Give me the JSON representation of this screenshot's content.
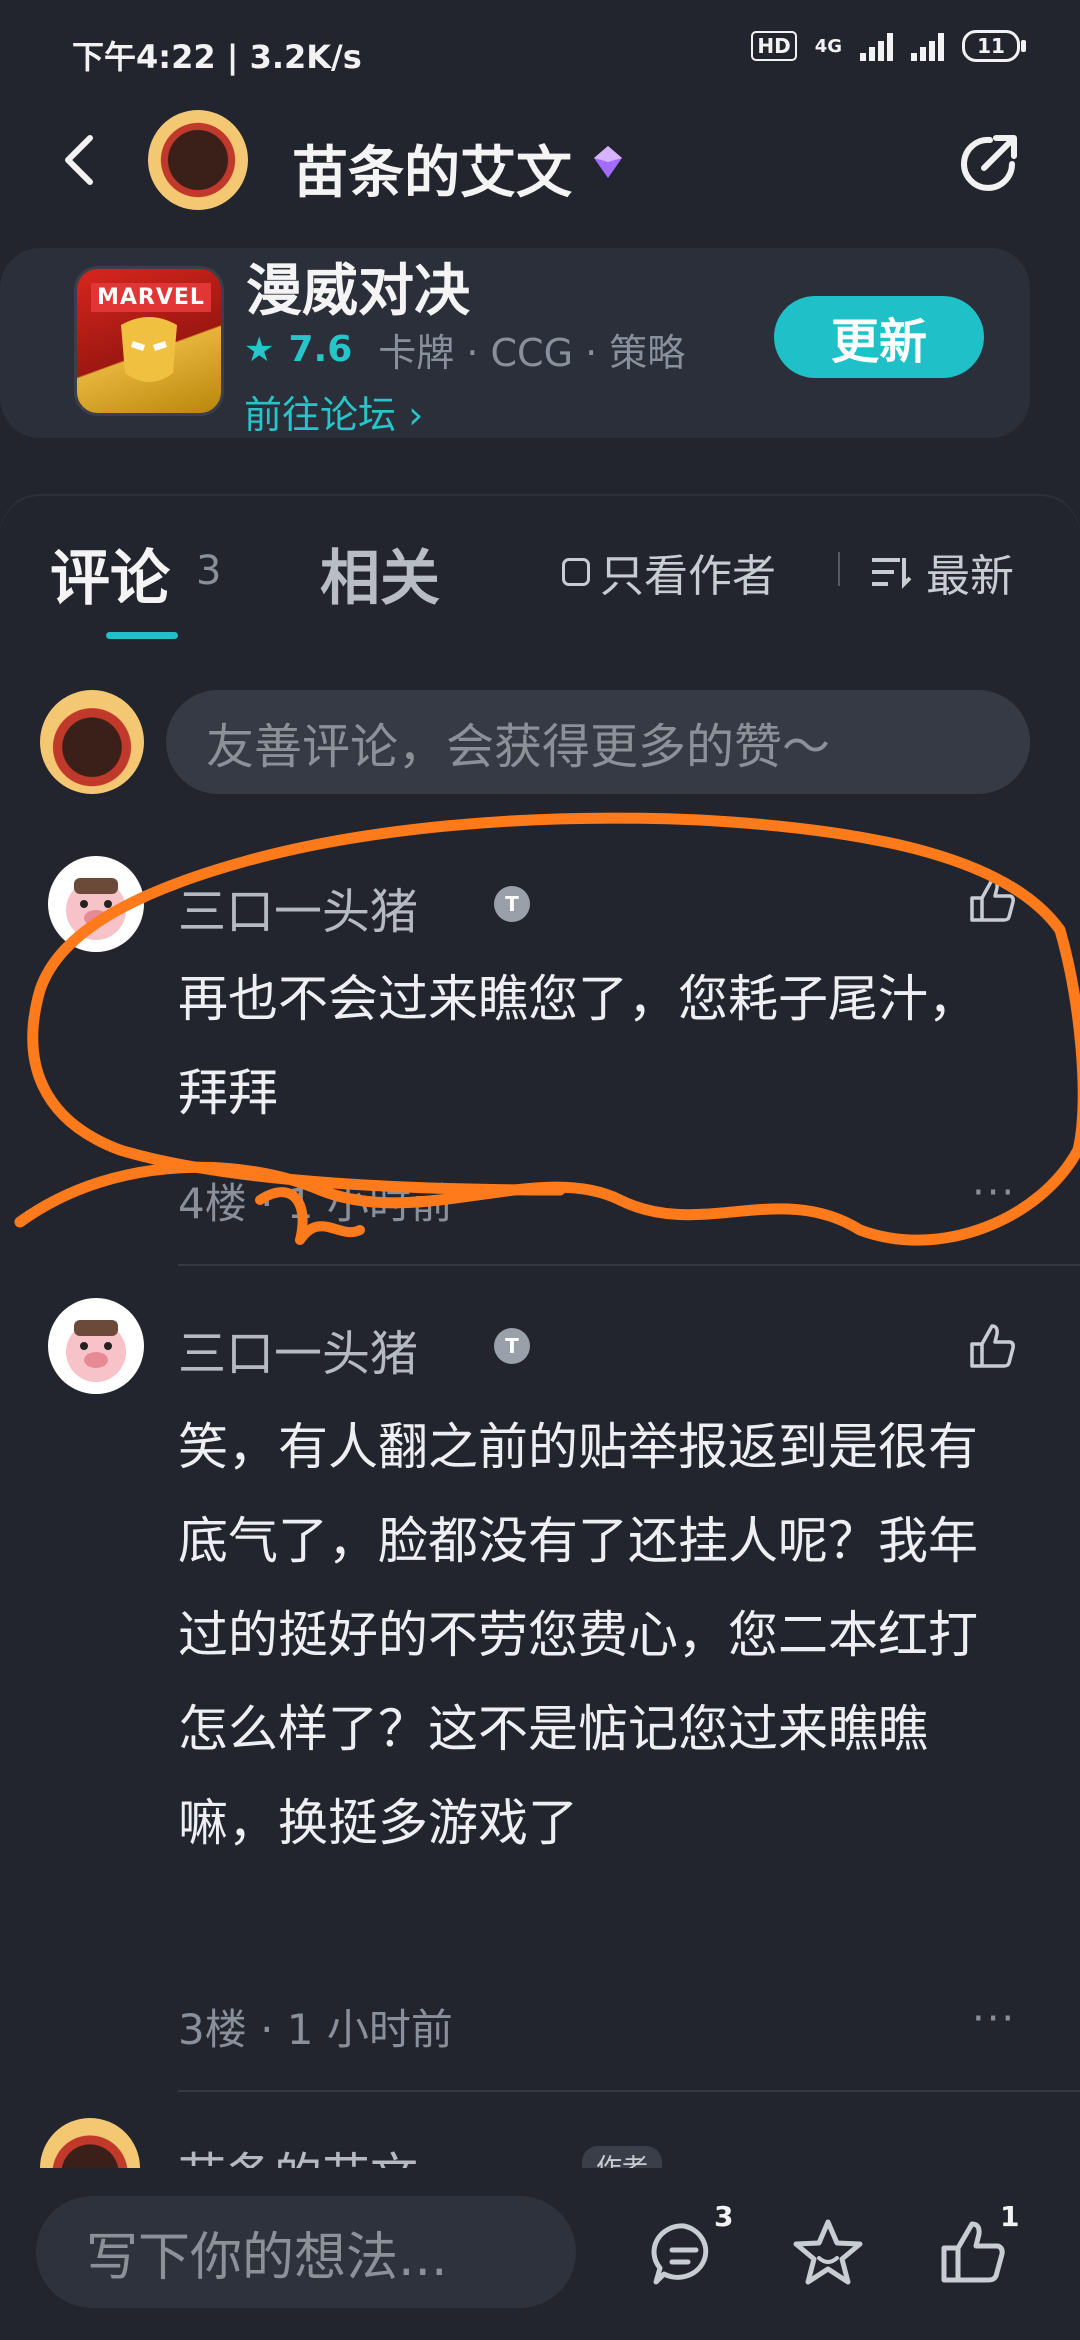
{
  "status_bar": {
    "time_speed": "下午4:22 | 3.2K/s",
    "hd": "HD",
    "network": "4G",
    "battery": "11"
  },
  "header": {
    "title": "苗条的艾文"
  },
  "game": {
    "logo_text": "MARVEL",
    "name": "漫威对决",
    "rating": "7.6",
    "tags": "卡牌 · CCG · 策略",
    "forum_link": "前往论坛 ›",
    "update_label": "更新"
  },
  "tabs": {
    "comments_label": "评论",
    "comments_count": "3",
    "related_label": "相关",
    "author_only_label": "只看作者",
    "sort_label": "最新"
  },
  "composer": {
    "placeholder": "友善评论，会获得更多的赞～"
  },
  "comments": [
    {
      "author": "三口一头猪",
      "badge": "T",
      "text": "再也不会过来瞧您了，您耗子尾汁，拜拜",
      "meta": "4楼 · 1 小时前"
    },
    {
      "author": "三口一头猪",
      "badge": "T",
      "text": "笑，有人翻之前的贴举报返到是很有底气了，脸都没有了还挂人呢？我年过的挺好的不劳您费心，您二本红打怎么样了？这不是惦记您过来瞧瞧嘛，换挺多游戏了",
      "meta": "3楼 · 1 小时前"
    },
    {
      "author": "苗条的艾文",
      "badge": "作者"
    }
  ],
  "bottom_bar": {
    "write_placeholder": "写下你的想法...",
    "comment_count": "3",
    "like_count": "1"
  },
  "colors": {
    "accent": "#1fc0c7",
    "background": "#22252e",
    "annotation": "#ff7a1a"
  }
}
